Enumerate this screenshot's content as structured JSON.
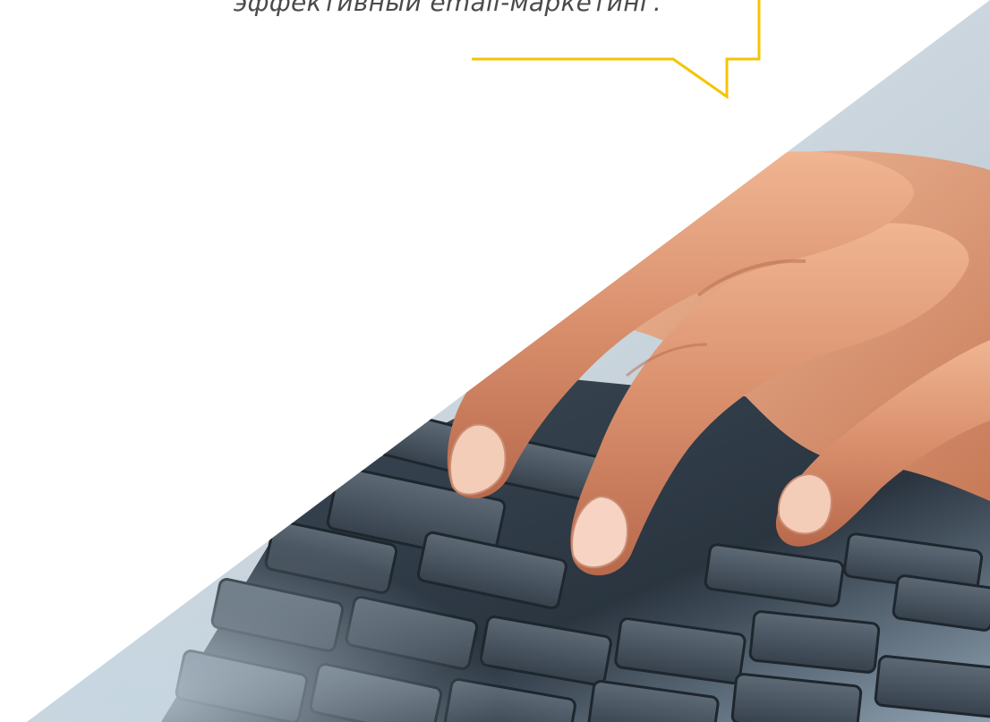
{
  "quote": {
    "text": "эффективный email-маркетинг."
  },
  "colors": {
    "bubble_border": "#f5c400",
    "text": "#4a4a4a",
    "background": "#ffffff"
  },
  "image": {
    "subject": "hand-typing-on-keyboard-photo"
  }
}
